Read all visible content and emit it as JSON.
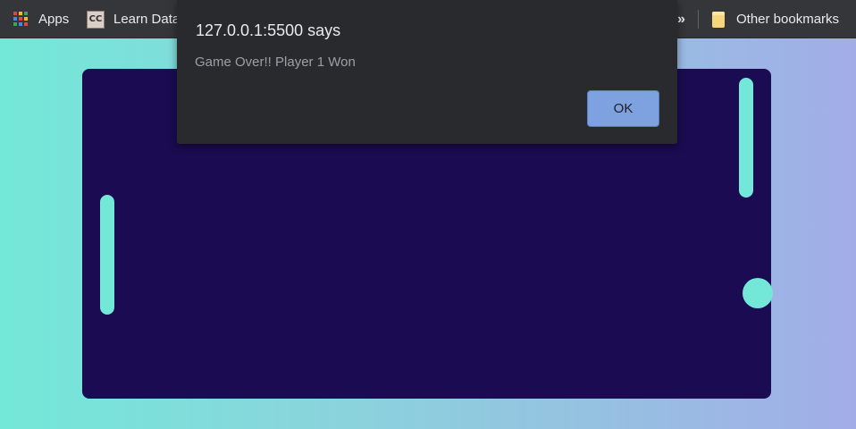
{
  "bookmarks": {
    "apps_label": "Apps",
    "learn_label": "Learn Data",
    "learn_icon_text": "CC",
    "overflow_label": "»",
    "other_label": "Other bookmarks"
  },
  "alert": {
    "title": "127.0.0.1:5500 says",
    "message": "Game Over!! Player 1 Won",
    "ok_label": "OK"
  },
  "colors": {
    "board": "#1b0b52",
    "paddle": "#73e8d8",
    "ball": "#73e8d8",
    "dialog_background": "#292a2d",
    "ok_button": "#7ea1e0",
    "apps_icon": [
      "#ea4335",
      "#fbbc04",
      "#34a853",
      "#4285f4",
      "#ea4335",
      "#fbbc04",
      "#34a853",
      "#4285f4",
      "#ea4335"
    ]
  },
  "icons": {
    "apps": "apps-grid-icon",
    "learn": "learn-data-icon",
    "other": "folder-icon"
  }
}
